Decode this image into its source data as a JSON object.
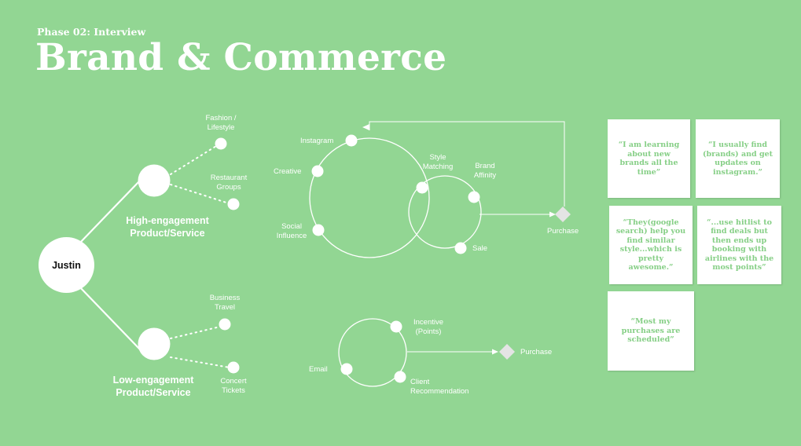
{
  "header": {
    "phase": "Phase 02: Interview",
    "title": "Brand & Commerce"
  },
  "persona": {
    "name": "Justin"
  },
  "segments": {
    "high": {
      "label": "High-engagement Product/Service",
      "items": [
        "Fashion / Lifestyle",
        "Restaurant Groups"
      ]
    },
    "low": {
      "label": "Low-engagement Product/Service",
      "items": [
        "Business Travel",
        "Concert Tickets"
      ]
    }
  },
  "flow_high": {
    "nodes": [
      "Instagram",
      "Creative",
      "Social Influence",
      "Style Matching",
      "Brand Affinity",
      "Sale"
    ],
    "outcome": "Purchase"
  },
  "flow_low": {
    "nodes": [
      "Incentive (Points)",
      "Email",
      "Client Recommendation"
    ],
    "outcome": "Purchase"
  },
  "quotes": [
    "“I am learning about new brands all the time”",
    "“I usually find (brands) and get updates on instagram.”",
    "“They(google search) help you find similar style...which is pretty awesome.”",
    "“...use hitlist to find deals but then ends up booking with airlines with the most points”",
    "“Most my purchases are scheduled”"
  ],
  "colors": {
    "background": "#92d693",
    "foreground": "#ffffff",
    "quote_text": "#86cf86"
  }
}
